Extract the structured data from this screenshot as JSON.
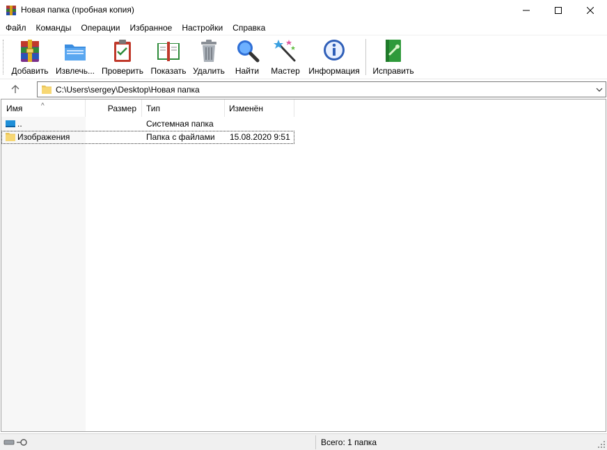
{
  "window": {
    "title": "Новая папка (пробная копия)"
  },
  "menu": {
    "items": [
      "Файл",
      "Команды",
      "Операции",
      "Избранное",
      "Настройки",
      "Справка"
    ]
  },
  "toolbar": {
    "buttons": [
      {
        "label": "Добавить",
        "icon": "add-archive-icon"
      },
      {
        "label": "Извлечь...",
        "icon": "extract-folder-icon"
      },
      {
        "label": "Проверить",
        "icon": "test-clipboard-icon"
      },
      {
        "label": "Показать",
        "icon": "view-book-icon"
      },
      {
        "label": "Удалить",
        "icon": "trash-icon"
      },
      {
        "label": "Найти",
        "icon": "magnifier-icon"
      },
      {
        "label": "Мастер",
        "icon": "wizard-wand-icon"
      },
      {
        "label": "Информация",
        "icon": "info-icon"
      },
      {
        "label": "Исправить",
        "icon": "repair-icon"
      }
    ]
  },
  "address": {
    "path": "C:\\Users\\sergey\\Desktop\\Новая папка"
  },
  "columns": {
    "name": "Имя",
    "size": "Размер",
    "type": "Тип",
    "modified": "Изменён"
  },
  "rows": [
    {
      "name": "..",
      "size": "",
      "type": "Системная папка",
      "modified": "",
      "icon": "parent-folder-icon"
    },
    {
      "name": "Изображения",
      "size": "",
      "type": "Папка с файлами",
      "modified": "15.08.2020 9:51",
      "icon": "folder-icon"
    }
  ],
  "status": {
    "summary": "Всего: 1 папка"
  },
  "colors": {
    "folder_yellow": "#f7d774",
    "accent_blue": "#0078d7",
    "selection_outline": "#303030"
  }
}
